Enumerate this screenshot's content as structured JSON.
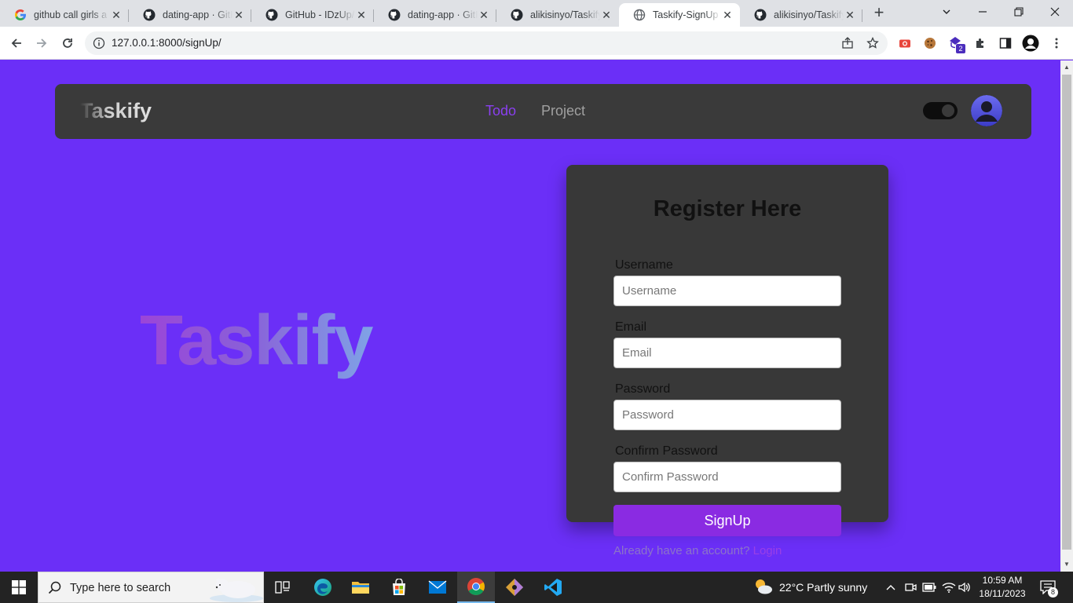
{
  "browser": {
    "tabs": [
      {
        "title": "github call girls a",
        "icon": "google-icon"
      },
      {
        "title": "dating-app · GitH",
        "icon": "github-icon"
      },
      {
        "title": "GitHub - IDzUp/d",
        "icon": "github-icon"
      },
      {
        "title": "dating-app · GitH",
        "icon": "github-icon"
      },
      {
        "title": "alikisinyo/Taskify",
        "icon": "github-icon"
      },
      {
        "title": "Taskify-SignUp P",
        "icon": "globe-icon",
        "active": true
      },
      {
        "title": "alikisinyo/Taskify",
        "icon": "github-icon"
      }
    ],
    "new_tab_label": "+",
    "url": "127.0.0.1:8000/signUp/",
    "extension_badge": "2"
  },
  "app": {
    "brand": "Taskify",
    "nav": {
      "todo": "Todo",
      "project": "Project"
    },
    "hero_text": "Taskify",
    "colors": {
      "background": "#6b2ff7",
      "card": "#383838",
      "accent": "#8a2be2"
    }
  },
  "form": {
    "title": "Register Here",
    "fields": [
      {
        "label": "Username",
        "placeholder": "Username"
      },
      {
        "label": "Email",
        "placeholder": "Email"
      },
      {
        "label": "Password",
        "placeholder": "Password"
      },
      {
        "label": "Confirm Password",
        "placeholder": "Confirm Password"
      }
    ],
    "submit_label": "SignUp",
    "login_prompt": "Already have an account?",
    "login_link": "Login"
  },
  "taskbar": {
    "search_placeholder": "Type here to search",
    "weather": "22°C  Partly sunny",
    "time": "10:59 AM",
    "date": "18/11/2023",
    "notification_count": "8"
  }
}
